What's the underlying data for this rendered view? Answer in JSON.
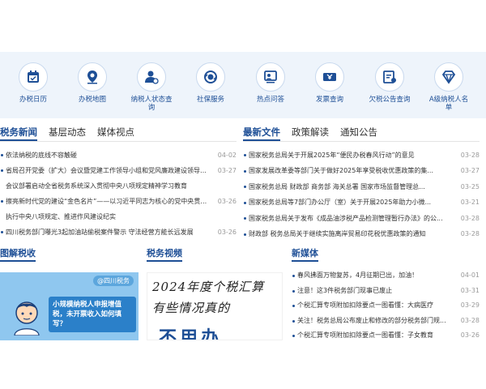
{
  "services": [
    {
      "label": "办税日历",
      "icon": "calendar-icon"
    },
    {
      "label": "办税地图",
      "icon": "map-pin-icon"
    },
    {
      "label": "纳税人状态查询",
      "icon": "person-status-icon"
    },
    {
      "label": "社保服务",
      "icon": "social-security-icon"
    },
    {
      "label": "热点问答",
      "icon": "qa-icon"
    },
    {
      "label": "发票查询",
      "icon": "invoice-icon"
    },
    {
      "label": "欠税公告查询",
      "icon": "tax-notice-icon"
    },
    {
      "label": "A级纳税人名单",
      "icon": "diamond-icon"
    }
  ],
  "left_tabs": [
    "税务新闻",
    "基层动态",
    "媒体视点"
  ],
  "right_tabs": [
    "最新文件",
    "政策解读",
    "通知公告"
  ],
  "left_news": [
    {
      "title": "依法纳税的底线不容触碰",
      "date": "04-02"
    },
    {
      "title": "省局召开党委（扩大）会议暨党建工作领导小组和党风廉政建设领导小组会议部署启动全省税务系统深入贯彻中央八项规定精神学习教育",
      "date": "03-27"
    },
    {
      "title": "擦亮新时代党的建设“金色名片”——以习近平同志为核心的党中央贯彻执行中央八项规定、推进作风建设纪实",
      "date": "03-26"
    },
    {
      "title": "四川税务部门曝光3起加油站偷税案件警示 守法经营方能长远发展",
      "date": "03-26"
    }
  ],
  "left_news_sub": {
    "item2": "会议部署启动全省税务系统深入贯彻中央八项规定精神学习教育",
    "item3": "执行中央八项规定、推进作风建设纪实"
  },
  "right_news": [
    {
      "title": "国家税务总局关于开展2025年“便民办税春风行动”的意见",
      "date": "03-28"
    },
    {
      "title": "国家发展改革委等部门关于做好2025年享受税收优惠政策的集...",
      "date": "03-27"
    },
    {
      "title": "国家税务总局 财政部 商务部 海关总署 国家市场监督管理总...",
      "date": "03-25"
    },
    {
      "title": "国家税务总局等7部门办公厅（室）关于开展2025年助力小微...",
      "date": "03-21"
    },
    {
      "title": "国家税务总局关于发布《成品油涉税产品检测管理暂行办法》的公...",
      "date": "03-28"
    },
    {
      "title": "财政部 税务总局关于继续实施离岸贸易印花税优惠政策的通知",
      "date": "03-28"
    }
  ],
  "sections": {
    "pics": "图解税收",
    "videos": "税务视频",
    "media": "新媒体"
  },
  "pic_card": {
    "badge": "@四川税务",
    "headline": "小规模纳税人申报增值税，未开票收入如何填写？"
  },
  "video_card": {
    "line1": "2024年度个税汇算",
    "line2": "有些情况真的",
    "line3": "不用办"
  },
  "media_news": [
    {
      "title": "春风拂面万物复苏，4月征期已出，加油！",
      "date": "04-01"
    },
    {
      "title": "注意！这3件税务部门现事已废止",
      "date": "03-31"
    },
    {
      "title": "个税汇算专项附加扣除要点一图看懂：大病医疗",
      "date": "03-29"
    },
    {
      "title": "关注！税务总局公布废止和修改的部分税务部门规...",
      "date": "03-28"
    },
    {
      "title": "个税汇算专项附加扣除要点一图看懂：子女教育",
      "date": "03-26"
    }
  ],
  "colors": {
    "brand": "#1e4f96",
    "service_bg": "#eef4fb",
    "date": "#999999"
  }
}
